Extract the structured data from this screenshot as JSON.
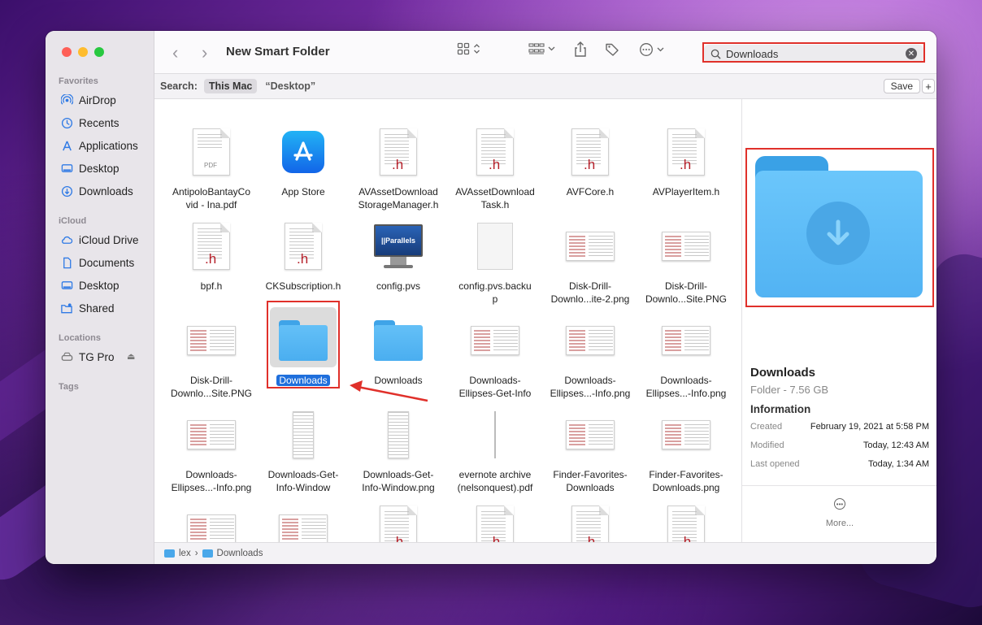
{
  "window": {
    "title": "New Smart Folder"
  },
  "sidebar": {
    "sections": [
      {
        "label": "Favorites",
        "items": [
          {
            "label": "AirDrop",
            "icon": "airdrop-icon"
          },
          {
            "label": "Recents",
            "icon": "clock-icon"
          },
          {
            "label": "Applications",
            "icon": "applications-icon"
          },
          {
            "label": "Desktop",
            "icon": "desktop-icon"
          },
          {
            "label": "Downloads",
            "icon": "download-icon"
          }
        ]
      },
      {
        "label": "iCloud",
        "items": [
          {
            "label": "iCloud Drive",
            "icon": "cloud-icon"
          },
          {
            "label": "Documents",
            "icon": "document-icon"
          },
          {
            "label": "Desktop",
            "icon": "desktop-icon"
          },
          {
            "label": "Shared",
            "icon": "shared-folder-icon"
          }
        ]
      },
      {
        "label": "Locations",
        "items": [
          {
            "label": "TG Pro",
            "icon": "drive-icon"
          }
        ]
      },
      {
        "label": "Tags",
        "items": []
      }
    ]
  },
  "search": {
    "value": "Downloads",
    "placeholder": "Search"
  },
  "scope": {
    "label": "Search:",
    "this_mac": "This Mac",
    "desktop": "“Desktop”",
    "save_label": "Save",
    "add_label": "+"
  },
  "files": [
    {
      "name": "AntipoloBantayCo\nvid - Ina.pdf",
      "kind": "pdf"
    },
    {
      "name": "App Store",
      "kind": "app"
    },
    {
      "name": "AVAssetDownload\nStorageManager.h",
      "kind": "h"
    },
    {
      "name": "AVAssetDownload\nTask.h",
      "kind": "h"
    },
    {
      "name": "AVFCore.h",
      "kind": "h"
    },
    {
      "name": "AVPlayerItem.h",
      "kind": "h"
    },
    {
      "name": "bpf.h",
      "kind": "h"
    },
    {
      "name": "CKSubscription.h",
      "kind": "h"
    },
    {
      "name": "config.pvs",
      "kind": "pvs"
    },
    {
      "name": "config.pvs.backu\np",
      "kind": "blank"
    },
    {
      "name": "Disk-Drill-\nDownlo...ite-2.png",
      "kind": "shot"
    },
    {
      "name": "Disk-Drill-\nDownlo...Site.PNG",
      "kind": "shot"
    },
    {
      "name": "Disk-Drill-\nDownlo...Site.PNG",
      "kind": "shot"
    },
    {
      "name": "Downloads",
      "kind": "folder-selected"
    },
    {
      "name": "Downloads",
      "kind": "folder"
    },
    {
      "name": "Downloads-\nEllipses-Get-Info",
      "kind": "shot"
    },
    {
      "name": "Downloads-\nEllipses...-Info.png",
      "kind": "shot"
    },
    {
      "name": "Downloads-\nEllipses...-Info.png",
      "kind": "shot"
    },
    {
      "name": "Downloads-\nEllipses...-Info.png",
      "kind": "shot"
    },
    {
      "name": "Downloads-Get-\nInfo-Window",
      "kind": "tall"
    },
    {
      "name": "Downloads-Get-\nInfo-Window.png",
      "kind": "tall"
    },
    {
      "name": "evernote archive\n(nelsonquest).pdf",
      "kind": "line"
    },
    {
      "name": "Finder-Favorites-\nDownloads",
      "kind": "shot"
    },
    {
      "name": "Finder-Favorites-\nDownloads.png",
      "kind": "shot"
    },
    {
      "name": "",
      "kind": "shot"
    },
    {
      "name": "",
      "kind": "shot"
    },
    {
      "name": "",
      "kind": "h"
    },
    {
      "name": "",
      "kind": "h"
    },
    {
      "name": "",
      "kind": "h"
    },
    {
      "name": "",
      "kind": "h"
    }
  ],
  "labels": {
    "h": ".h",
    "pdf": "PDF",
    "parallels": "||Parallels"
  },
  "preview": {
    "name": "Downloads",
    "kind": "Folder - 7.56 GB",
    "info_title": "Information",
    "rows": [
      {
        "key": "Created",
        "value": "February 19, 2021 at 5:58 PM"
      },
      {
        "key": "Modified",
        "value": "Today, 12:43 AM"
      },
      {
        "key": "Last opened",
        "value": "Today, 1:34 AM"
      }
    ],
    "more_label": "More..."
  },
  "pathbar": {
    "items": [
      "lex",
      "Downloads"
    ],
    "separator": "›"
  },
  "colors": {
    "accent": "#1f6fdc",
    "highlight": "#e0302a",
    "folder": "#5ab8f5"
  }
}
